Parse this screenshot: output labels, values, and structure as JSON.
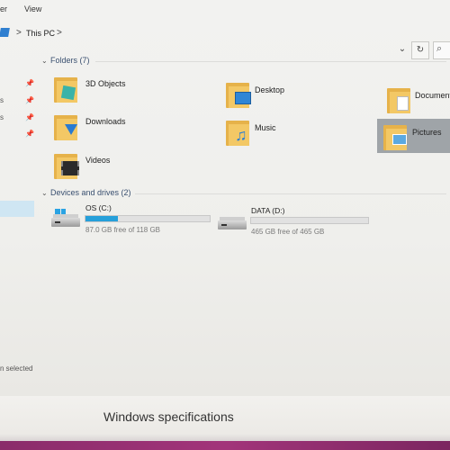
{
  "ribbon": {
    "left_fragment": "er",
    "view": "View"
  },
  "address": {
    "sep1": ">",
    "location": "This PC",
    "sep2": ">",
    "dropdown": "⌄",
    "refresh": "↻",
    "search_icon": "⌕"
  },
  "sidebar": {
    "frag1": "s",
    "frag2": "s"
  },
  "groups": {
    "folders": {
      "chevron": "⌄",
      "title": "Folders (7)"
    },
    "drives": {
      "chevron": "⌄",
      "title": "Devices and drives (2)"
    }
  },
  "folders": [
    {
      "name": "3D Objects",
      "icon": "3d-objects-folder-icon"
    },
    {
      "name": "Desktop",
      "icon": "desktop-folder-icon"
    },
    {
      "name": "Documents",
      "icon": "documents-folder-icon"
    },
    {
      "name": "Downloads",
      "icon": "downloads-folder-icon"
    },
    {
      "name": "Music",
      "icon": "music-folder-icon"
    },
    {
      "name": "Pictures",
      "icon": "pictures-folder-icon",
      "selected": true
    },
    {
      "name": "Videos",
      "icon": "videos-folder-icon"
    }
  ],
  "drives": [
    {
      "name": "OS (C:)",
      "info": "87.0 GB free of 118 GB",
      "used_fraction": 0.26,
      "icon": "windows-drive-icon"
    },
    {
      "name": "DATA (D:)",
      "info": "465 GB free of 465 GB",
      "used_fraction": 0.0,
      "icon": "hard-drive-icon"
    }
  ],
  "status": {
    "text": "n selected"
  },
  "caption": {
    "text": "Windows specifications"
  },
  "colors": {
    "accent": "#26a0da",
    "folder": "#f3c865",
    "selection": "#9fa4a8"
  }
}
